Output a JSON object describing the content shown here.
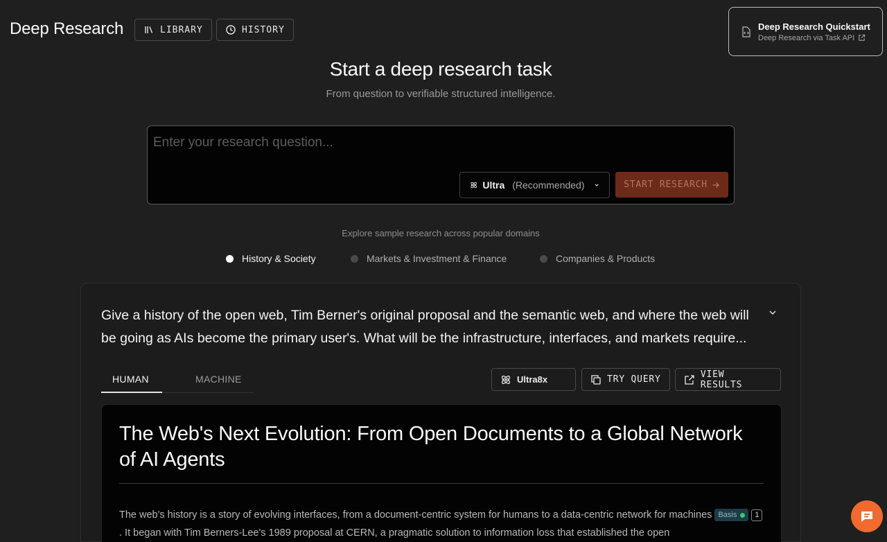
{
  "header": {
    "brand": "Deep Research",
    "library_label": "LIBRARY",
    "history_label": "HISTORY"
  },
  "quickstart": {
    "title": "Deep Research Quickstart",
    "subtitle": "Deep Research via Task API"
  },
  "hero": {
    "title": "Start a deep research task",
    "subtitle": "From question to verifiable structured intelligence."
  },
  "query": {
    "placeholder": "Enter your research question...",
    "value": "",
    "model_name": "Ultra",
    "model_note": "(Recommended)",
    "start_label": "START RESEARCH"
  },
  "explore": {
    "label": "Explore sample research across popular domains",
    "domains": [
      {
        "label": "History & Society",
        "active": true
      },
      {
        "label": "Markets & Investment & Finance",
        "active": false
      },
      {
        "label": "Companies & Products",
        "active": false
      }
    ]
  },
  "sample": {
    "question": "Give a history of the open web, Tim Berner's original proposal and the semantic web, and where the web will be going as AIs become the primary user's. What will be the infrastructure, interfaces, and markets require...",
    "tabs": [
      "HUMAN",
      "MACHINE"
    ],
    "active_tab": "HUMAN",
    "processor_label": "Ultra8x",
    "try_query_label": "TRY QUERY",
    "view_results_label": "VIEW RESULTS",
    "report": {
      "title": "The Web's Next Evolution: From Open Documents to a Global Network of AI Agents",
      "para_part1": "The web's history is a story of evolving interfaces, from a document-centric system for humans to a data-centric network for machines",
      "basis_label": "Basis",
      "citation": "1",
      "para_part2": ". It began with Tim Berners-Lee's 1989 proposal at CERN, a pragmatic solution to information loss that established the open"
    }
  },
  "colors": {
    "background": "#1f1f1f",
    "accent": "#6c2a18",
    "chat_button": "#f26a2e"
  }
}
